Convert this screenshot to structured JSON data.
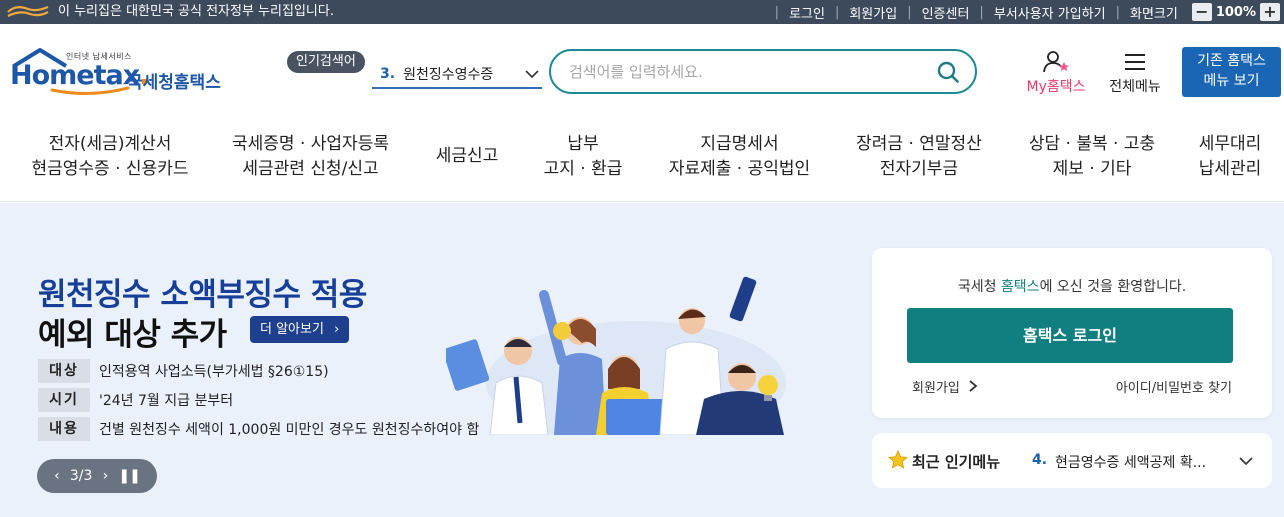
{
  "gov_bar": {
    "logo": "eG",
    "notice": "이 누리집은 대한민국 공식 전자정부 누리집입니다.",
    "links": [
      "로그인",
      "회원가입",
      "인증센터",
      "부서사용자 가입하기",
      "화면크기"
    ],
    "zoom_minus": "−",
    "zoom_value": "100%",
    "zoom_plus": "+"
  },
  "header": {
    "logo_tag": "인터넷 납세서비스",
    "logo_word": "Hometax",
    "logo_dot": ".",
    "logo_korean": "국세청홈택스",
    "popular_badge": "인기검색어",
    "popular_num": "3.",
    "popular_term": "원천징수영수증",
    "search_placeholder": "검색어를 입력하세요.",
    "my_prefix": "My",
    "my_suffix": "홈택스",
    "all_menu": "전체메뉴",
    "legacy_line1": "기존 홈택스",
    "legacy_line2": "메뉴 보기"
  },
  "gnb": [
    {
      "line1": "전자(세금)계산서",
      "line2": "현금영수증 · 신용카드"
    },
    {
      "line1": "국세증명 · 사업자등록",
      "line2": "세금관련 신청/신고"
    },
    {
      "line1": "세금신고",
      "line2": ""
    },
    {
      "line1": "납부",
      "line2": "고지 · 환급"
    },
    {
      "line1": "지급명세서",
      "line2": "자료제출 · 공익법인"
    },
    {
      "line1": "장려금 · 연말정산",
      "line2": "전자기부금"
    },
    {
      "line1": "상담 · 불복 · 고충",
      "line2": "제보 · 기타"
    },
    {
      "line1": "세무대리",
      "line2": "납세관리"
    }
  ],
  "hero": {
    "title_line1": "원천징수 소액부징수 적용",
    "title_line2": "예외 대상 추가",
    "more_button": "더 알아보기",
    "rows": [
      {
        "key": "대상",
        "value": "인적용역 사업소득(부가세법 §26①15)"
      },
      {
        "key": "시기",
        "value": "'24년 7월 지급 분부터"
      },
      {
        "key": "내용",
        "value": "건별 원천징수 세액이 1,000원 미만인 경우도 원천징수하여야 함"
      }
    ],
    "slide_counter": "3/3"
  },
  "login": {
    "welcome_pre": "국세청 ",
    "welcome_hl": "홈택스",
    "welcome_post": "에 오신 것을 환영합니다.",
    "login_button": "홈택스 로그인",
    "join": "회원가입",
    "find": "아이디/비밀번호 찾기"
  },
  "recent": {
    "title": "최근 인기메뉴",
    "num": "4.",
    "value": "현금영수증 세액공제 확..."
  },
  "colors": {
    "gov_bar": "#3d4a5c",
    "brand_blue": "#1e56a8",
    "search_border": "#1e8a94",
    "login_teal": "#117f80",
    "hero_bg": "#eaf1fb",
    "hero_title": "#173f9a"
  }
}
